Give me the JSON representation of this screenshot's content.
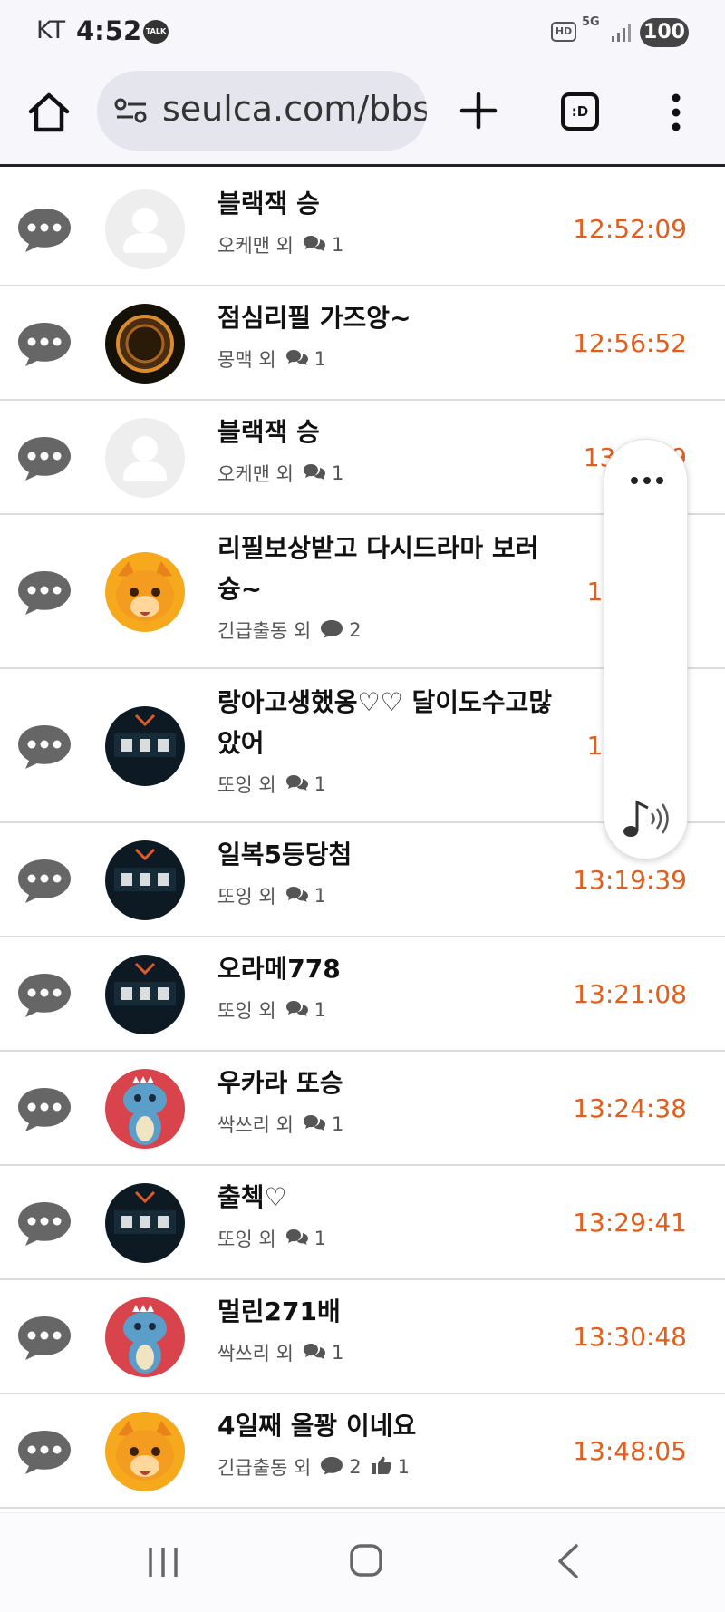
{
  "status_bar": {
    "carrier": "KT",
    "time": "4:52",
    "talk_badge": "TALK",
    "hd": "HD",
    "network": "5G",
    "battery": "100"
  },
  "browser": {
    "url": "seulca.com/bbs",
    "tabs_count_label": ":D"
  },
  "posts": [
    {
      "title": "블랙잭 승",
      "author": "오케맨 외",
      "comments": "1",
      "likes": null,
      "time": "12:52:09",
      "avatar": "default"
    },
    {
      "title": "점심리필 가즈앙~",
      "author": "몽맥 외",
      "comments": "1",
      "likes": null,
      "time": "12:56:52",
      "avatar": "dark-emblem"
    },
    {
      "title": "블랙잭 승",
      "author": "오케맨 외",
      "comments": "1",
      "likes": null,
      "time": "13:__:_9",
      "avatar": "default"
    },
    {
      "title": "리필보상받고 다시드라마 보러 슝~",
      "author": "긴급출동 외",
      "comments": "2",
      "likes": null,
      "time": "13:__:__",
      "avatar": "orange-cat"
    },
    {
      "title": "랑아고생했옹♡♡ 달이도수고많았어",
      "author": "또잉 외",
      "comments": "1",
      "likes": null,
      "time": "13:__:__",
      "avatar": "like-sign"
    },
    {
      "title": "일복5등당첨",
      "author": "또잉 외",
      "comments": "1",
      "likes": null,
      "time": "13:19:39",
      "avatar": "like-sign"
    },
    {
      "title": "오라메778",
      "author": "또잉 외",
      "comments": "1",
      "likes": null,
      "time": "13:21:08",
      "avatar": "like-sign"
    },
    {
      "title": "우카라 또승",
      "author": "싹쓰리 외",
      "comments": "1",
      "likes": null,
      "time": "13:24:38",
      "avatar": "blue-dino"
    },
    {
      "title": "출첵♡",
      "author": "또잉 외",
      "comments": "1",
      "likes": null,
      "time": "13:29:41",
      "avatar": "like-sign"
    },
    {
      "title": "멀린271배",
      "author": "싹쓰리 외",
      "comments": "1",
      "likes": null,
      "time": "13:30:48",
      "avatar": "blue-dino"
    },
    {
      "title": "4일째 올꽝 이네요",
      "author": "긴급출동 외",
      "comments": "2",
      "likes": "1",
      "time": "13:48:05",
      "avatar": "orange-cat"
    }
  ],
  "colors": {
    "time_accent": "#e25e1c",
    "icon_gray": "#666666"
  }
}
